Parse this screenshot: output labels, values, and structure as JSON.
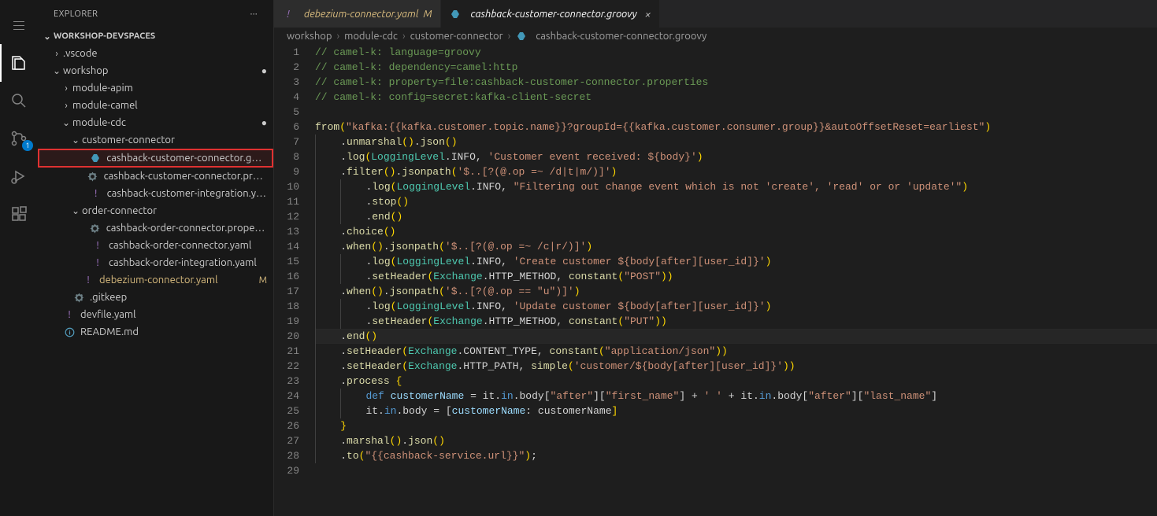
{
  "sidebarTitle": "EXPLORER",
  "sectionTitle": "WORKSHOP-DEVSPACES",
  "scmBadge": "1",
  "tree": [
    {
      "indent": 0,
      "twistie": "›",
      "label": ".vscode",
      "kind": "folder"
    },
    {
      "indent": 0,
      "twistie": "⌄",
      "label": "workshop",
      "kind": "folder",
      "status": "●"
    },
    {
      "indent": 1,
      "twistie": "›",
      "label": "module-apim",
      "kind": "folder"
    },
    {
      "indent": 1,
      "twistie": "›",
      "label": "module-camel",
      "kind": "folder"
    },
    {
      "indent": 1,
      "twistie": "⌄",
      "label": "module-cdc",
      "kind": "folder",
      "status": "●"
    },
    {
      "indent": 2,
      "twistie": "⌄",
      "label": "customer-connector",
      "kind": "folder"
    },
    {
      "indent": 3,
      "icon": "groovy",
      "label": "cashback-customer-connector.groovy",
      "highlight": true
    },
    {
      "indent": 3,
      "icon": "gear",
      "label": "cashback-customer-connector.proper…"
    },
    {
      "indent": 3,
      "icon": "yaml",
      "label": "cashback-customer-integration.yaml"
    },
    {
      "indent": 2,
      "twistie": "⌄",
      "label": "order-connector",
      "kind": "folder"
    },
    {
      "indent": 3,
      "icon": "gear",
      "label": "cashback-order-connector.properties"
    },
    {
      "indent": 3,
      "icon": "yaml",
      "label": "cashback-order-connector.yaml"
    },
    {
      "indent": 3,
      "icon": "yaml",
      "label": "cashback-order-integration.yaml"
    },
    {
      "indent": 2,
      "icon": "yaml",
      "label": "debezium-connector.yaml",
      "status": "M"
    },
    {
      "indent": 1,
      "icon": "gear",
      "label": ".gitkeep"
    },
    {
      "indent": 0,
      "icon": "yaml",
      "label": "devfile.yaml"
    },
    {
      "indent": 0,
      "icon": "md",
      "label": "README.md"
    }
  ],
  "tabs": [
    {
      "icon": "yaml",
      "label": "debezium-connector.yaml",
      "suffix": "M",
      "mod": true
    },
    {
      "icon": "groovy",
      "label": "cashback-customer-connector.groovy",
      "active": true,
      "close": "×"
    }
  ],
  "breadcrumbs": [
    "workshop",
    "module-cdc",
    "customer-connector",
    "cashback-customer-connector.groovy"
  ],
  "code": [
    {
      "n": 1,
      "tokens": [
        [
          "c-comment",
          "// camel-k: language=groovy"
        ]
      ]
    },
    {
      "n": 2,
      "tokens": [
        [
          "c-comment",
          "// camel-k: dependency=camel:http"
        ]
      ]
    },
    {
      "n": 3,
      "tokens": [
        [
          "c-comment",
          "// camel-k: property=file:cashback-customer-connector.properties"
        ]
      ]
    },
    {
      "n": 4,
      "tokens": [
        [
          "c-comment",
          "// camel-k: config=secret:kafka-client-secret"
        ]
      ]
    },
    {
      "n": 5,
      "tokens": []
    },
    {
      "n": 6,
      "tokens": [
        [
          "c-fn",
          "from"
        ],
        [
          "c-paren",
          "("
        ],
        [
          "c-str",
          "\"kafka:{{kafka.customer.topic.name}}?groupId={{kafka.customer.consumer.group}}&autoOffsetReset=earliest\""
        ],
        [
          "c-paren",
          ")"
        ]
      ]
    },
    {
      "n": 7,
      "ind": 1,
      "tokens": [
        [
          "c-punct",
          "."
        ],
        [
          "c-fn",
          "unmarshal"
        ],
        [
          "c-paren",
          "()"
        ],
        [
          "c-punct",
          "."
        ],
        [
          "c-fn",
          "json"
        ],
        [
          "c-paren",
          "()"
        ]
      ]
    },
    {
      "n": 8,
      "ind": 1,
      "tokens": [
        [
          "c-punct",
          "."
        ],
        [
          "c-fn",
          "log"
        ],
        [
          "c-paren",
          "("
        ],
        [
          "c-type",
          "LoggingLevel"
        ],
        [
          "c-punct",
          "."
        ],
        [
          "c-const",
          "INFO"
        ],
        [
          "c-punct",
          ", "
        ],
        [
          "c-str",
          "'Customer event received: ${body}'"
        ],
        [
          "c-paren",
          ")"
        ]
      ]
    },
    {
      "n": 9,
      "ind": 1,
      "tokens": [
        [
          "c-punct",
          "."
        ],
        [
          "c-fn",
          "filter"
        ],
        [
          "c-paren",
          "()"
        ],
        [
          "c-punct",
          "."
        ],
        [
          "c-fn",
          "jsonpath"
        ],
        [
          "c-paren",
          "("
        ],
        [
          "c-str",
          "'$..[?(@.op =~ /d|t|m/)]'"
        ],
        [
          "c-paren",
          ")"
        ]
      ]
    },
    {
      "n": 10,
      "ind": 2,
      "tokens": [
        [
          "c-punct",
          "."
        ],
        [
          "c-fn",
          "log"
        ],
        [
          "c-paren",
          "("
        ],
        [
          "c-type",
          "LoggingLevel"
        ],
        [
          "c-punct",
          "."
        ],
        [
          "c-const",
          "INFO"
        ],
        [
          "c-punct",
          ", "
        ],
        [
          "c-str",
          "\"Filtering out change event which is not 'create', 'read' or or 'update'\""
        ],
        [
          "c-paren",
          ")"
        ]
      ]
    },
    {
      "n": 11,
      "ind": 2,
      "tokens": [
        [
          "c-punct",
          "."
        ],
        [
          "c-fn",
          "stop"
        ],
        [
          "c-paren",
          "()"
        ]
      ]
    },
    {
      "n": 12,
      "ind": 2,
      "tokens": [
        [
          "c-punct",
          "."
        ],
        [
          "c-fn",
          "end"
        ],
        [
          "c-paren",
          "()"
        ]
      ]
    },
    {
      "n": 13,
      "ind": 1,
      "tokens": [
        [
          "c-punct",
          "."
        ],
        [
          "c-fn",
          "choice"
        ],
        [
          "c-paren",
          "()"
        ]
      ]
    },
    {
      "n": 14,
      "ind": 1,
      "tokens": [
        [
          "c-punct",
          "."
        ],
        [
          "c-fn",
          "when"
        ],
        [
          "c-paren",
          "()"
        ],
        [
          "c-punct",
          "."
        ],
        [
          "c-fn",
          "jsonpath"
        ],
        [
          "c-paren",
          "("
        ],
        [
          "c-str",
          "'$..[?(@.op =~ /c|r/)]'"
        ],
        [
          "c-paren",
          ")"
        ]
      ]
    },
    {
      "n": 15,
      "ind": 2,
      "tokens": [
        [
          "c-punct",
          "."
        ],
        [
          "c-fn",
          "log"
        ],
        [
          "c-paren",
          "("
        ],
        [
          "c-type",
          "LoggingLevel"
        ],
        [
          "c-punct",
          "."
        ],
        [
          "c-const",
          "INFO"
        ],
        [
          "c-punct",
          ", "
        ],
        [
          "c-str",
          "'Create customer ${body[after][user_id]}'"
        ],
        [
          "c-paren",
          ")"
        ]
      ]
    },
    {
      "n": 16,
      "ind": 2,
      "tokens": [
        [
          "c-punct",
          "."
        ],
        [
          "c-fn",
          "setHeader"
        ],
        [
          "c-paren",
          "("
        ],
        [
          "c-type",
          "Exchange"
        ],
        [
          "c-punct",
          "."
        ],
        [
          "c-const",
          "HTTP_METHOD"
        ],
        [
          "c-punct",
          ", "
        ],
        [
          "c-fn",
          "constant"
        ],
        [
          "c-paren",
          "("
        ],
        [
          "c-str",
          "\"POST\""
        ],
        [
          "c-paren",
          "))"
        ]
      ]
    },
    {
      "n": 17,
      "ind": 1,
      "tokens": [
        [
          "c-punct",
          "."
        ],
        [
          "c-fn",
          "when"
        ],
        [
          "c-paren",
          "()"
        ],
        [
          "c-punct",
          "."
        ],
        [
          "c-fn",
          "jsonpath"
        ],
        [
          "c-paren",
          "("
        ],
        [
          "c-str",
          "'$..[?(@.op == \"u\")]'"
        ],
        [
          "c-paren",
          ")"
        ]
      ]
    },
    {
      "n": 18,
      "ind": 2,
      "tokens": [
        [
          "c-punct",
          "."
        ],
        [
          "c-fn",
          "log"
        ],
        [
          "c-paren",
          "("
        ],
        [
          "c-type",
          "LoggingLevel"
        ],
        [
          "c-punct",
          "."
        ],
        [
          "c-const",
          "INFO"
        ],
        [
          "c-punct",
          ", "
        ],
        [
          "c-str",
          "'Update customer ${body[after][user_id]}'"
        ],
        [
          "c-paren",
          ")"
        ]
      ]
    },
    {
      "n": 19,
      "ind": 2,
      "tokens": [
        [
          "c-punct",
          "."
        ],
        [
          "c-fn",
          "setHeader"
        ],
        [
          "c-paren",
          "("
        ],
        [
          "c-type",
          "Exchange"
        ],
        [
          "c-punct",
          "."
        ],
        [
          "c-const",
          "HTTP_METHOD"
        ],
        [
          "c-punct",
          ", "
        ],
        [
          "c-fn",
          "constant"
        ],
        [
          "c-paren",
          "("
        ],
        [
          "c-str",
          "\"PUT\""
        ],
        [
          "c-paren",
          "))"
        ]
      ]
    },
    {
      "n": 20,
      "ind": 1,
      "curr": true,
      "tokens": [
        [
          "c-punct",
          "."
        ],
        [
          "c-fn",
          "end"
        ],
        [
          "c-paren",
          "()"
        ]
      ]
    },
    {
      "n": 21,
      "ind": 1,
      "tokens": [
        [
          "c-punct",
          "."
        ],
        [
          "c-fn",
          "setHeader"
        ],
        [
          "c-paren",
          "("
        ],
        [
          "c-type",
          "Exchange"
        ],
        [
          "c-punct",
          "."
        ],
        [
          "c-const",
          "CONTENT_TYPE"
        ],
        [
          "c-punct",
          ", "
        ],
        [
          "c-fn",
          "constant"
        ],
        [
          "c-paren",
          "("
        ],
        [
          "c-str",
          "\"application/json\""
        ],
        [
          "c-paren",
          "))"
        ]
      ]
    },
    {
      "n": 22,
      "ind": 1,
      "tokens": [
        [
          "c-punct",
          "."
        ],
        [
          "c-fn",
          "setHeader"
        ],
        [
          "c-paren",
          "("
        ],
        [
          "c-type",
          "Exchange"
        ],
        [
          "c-punct",
          "."
        ],
        [
          "c-const",
          "HTTP_PATH"
        ],
        [
          "c-punct",
          ", "
        ],
        [
          "c-fn",
          "simple"
        ],
        [
          "c-paren",
          "("
        ],
        [
          "c-str",
          "'customer/${body[after][user_id]}'"
        ],
        [
          "c-paren",
          "))"
        ]
      ]
    },
    {
      "n": 23,
      "ind": 1,
      "tokens": [
        [
          "c-punct",
          "."
        ],
        [
          "c-fn",
          "process"
        ],
        [
          "c-punct",
          " "
        ],
        [
          "c-paren",
          "{"
        ]
      ]
    },
    {
      "n": 24,
      "ind": 2,
      "tokens": [
        [
          "c-keyword",
          "def"
        ],
        [
          "c-punct",
          " "
        ],
        [
          "c-prop",
          "customerName"
        ],
        [
          "c-punct",
          " = it."
        ],
        [
          "c-keyword",
          "in"
        ],
        [
          "c-punct",
          ".body["
        ],
        [
          "c-str",
          "\"after\""
        ],
        [
          "c-punct",
          "]["
        ],
        [
          "c-str",
          "\"first_name\""
        ],
        [
          "c-punct",
          "] + "
        ],
        [
          "c-str",
          "' '"
        ],
        [
          "c-punct",
          " + it."
        ],
        [
          "c-keyword",
          "in"
        ],
        [
          "c-punct",
          ".body["
        ],
        [
          "c-str",
          "\"after\""
        ],
        [
          "c-punct",
          "]["
        ],
        [
          "c-str",
          "\"last_name\""
        ],
        [
          "c-punct",
          "]"
        ]
      ]
    },
    {
      "n": 25,
      "ind": 2,
      "tokens": [
        [
          "c-punct",
          "it."
        ],
        [
          "c-keyword",
          "in"
        ],
        [
          "c-punct",
          ".body = ["
        ],
        [
          "c-prop",
          "customerName"
        ],
        [
          "c-punct",
          ": customerName"
        ],
        [
          "c-paren",
          "]"
        ]
      ]
    },
    {
      "n": 26,
      "ind": 1,
      "tokens": [
        [
          "c-paren",
          "}"
        ]
      ]
    },
    {
      "n": 27,
      "ind": 1,
      "tokens": [
        [
          "c-punct",
          "."
        ],
        [
          "c-fn",
          "marshal"
        ],
        [
          "c-paren",
          "()"
        ],
        [
          "c-punct",
          "."
        ],
        [
          "c-fn",
          "json"
        ],
        [
          "c-paren",
          "()"
        ]
      ]
    },
    {
      "n": 28,
      "ind": 1,
      "tokens": [
        [
          "c-punct",
          "."
        ],
        [
          "c-fn",
          "to"
        ],
        [
          "c-paren",
          "("
        ],
        [
          "c-str",
          "\"{{cashback-service.url}}\""
        ],
        [
          "c-paren",
          ")"
        ],
        [
          "c-punct",
          ";"
        ]
      ]
    },
    {
      "n": 29,
      "tokens": []
    }
  ]
}
